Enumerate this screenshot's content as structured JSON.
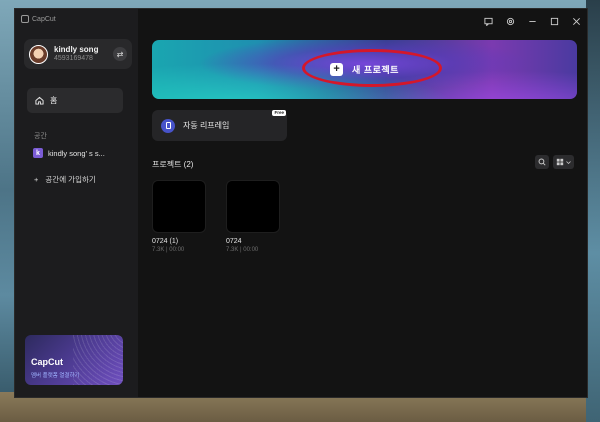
{
  "app": {
    "name": "CapCut"
  },
  "window_controls": [
    "feedback-icon",
    "settings-icon",
    "minimize-icon",
    "maximize-icon",
    "close-icon"
  ],
  "profile": {
    "name": "kindly song",
    "id": "4593169478",
    "swap_icon": "⇄"
  },
  "sidebar": {
    "home_label": "홈",
    "section_label": "공간",
    "space_badge": "k",
    "space_name": "kindly song’ s s...",
    "join_label": "공간에 가입하기",
    "join_icon": "+"
  },
  "promo": {
    "title": "CapCut",
    "subtitle": "멤버 플랫폼 열결하기"
  },
  "hero": {
    "label": "새 프로젝트",
    "plus": "+"
  },
  "auto_reframe": {
    "label": "자동 리프레임",
    "tag": "Free"
  },
  "projects": {
    "header": "프로젝트 (2)",
    "items": [
      {
        "name": "0724 (1)",
        "meta": "7.3K | 00:00"
      },
      {
        "name": "0724",
        "meta": "7.3K | 00:00"
      }
    ]
  },
  "colors": {
    "accent_red": "#d4172a",
    "hero_teal": "#1aa6b0",
    "hero_purple": "#7b3ab0"
  }
}
